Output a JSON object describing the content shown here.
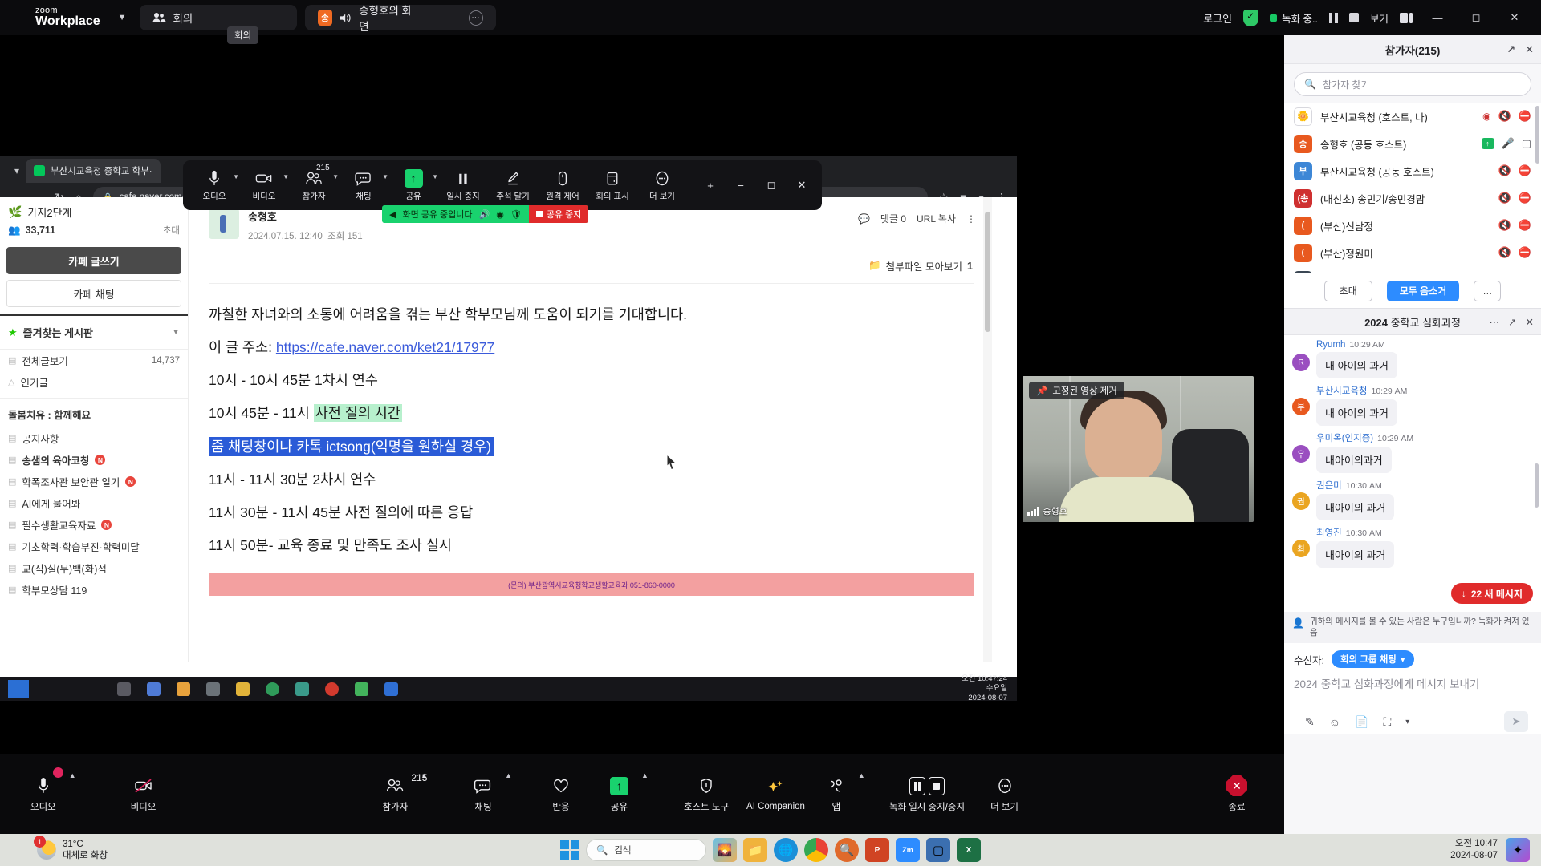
{
  "app": {
    "brand_line1": "zoom",
    "brand_line2": "Workplace",
    "tab_meeting": "회의",
    "tab_share": "송형호의 화면",
    "tab_share_badge": "송",
    "tooltip_meeting": "회의",
    "login": "로그인",
    "recording_status": "녹화 중..",
    "view_label": "보기"
  },
  "share_status": {
    "text": "화면 공유 중입니다",
    "stop_label": "공유 중지"
  },
  "float_controls": [
    {
      "label": "오디오",
      "icon": "microphone-icon",
      "caret": true
    },
    {
      "label": "비디오",
      "icon": "camera-icon",
      "caret": true
    },
    {
      "label": "참가자",
      "icon": "participants-icon",
      "caret": true,
      "count": "215"
    },
    {
      "label": "채팅",
      "icon": "chat-icon",
      "caret": true
    },
    {
      "label": "공유",
      "icon": "share-screen-icon",
      "caret": true
    },
    {
      "label": "일시 중지",
      "icon": "pause-icon",
      "caret": false
    },
    {
      "label": "주석 달기",
      "icon": "annotate-pen-icon",
      "caret": false
    },
    {
      "label": "원격 제어",
      "icon": "remote-control-icon",
      "caret": false
    },
    {
      "label": "회의 표시",
      "icon": "show-meeting-icon",
      "caret": false
    },
    {
      "label": "더 보기",
      "icon": "more-dots-icon",
      "caret": false
    }
  ],
  "browser": {
    "tab_title": "부산시교육청 중학교 학부·",
    "url": "cafe.naver.com/ket21/17977"
  },
  "naver_sidebar": {
    "cafe_name": "가지2단계",
    "member_count": "33,711",
    "invite": "초대",
    "write_button": "카페 글쓰기",
    "chat_button": "카페 채팅",
    "favorites_title": "즐겨찾는 게시판",
    "all_posts": "전체글보기",
    "all_posts_count": "14,737",
    "popular": "인기글",
    "group_title": "돌봄치유 : 함께해요",
    "boards": [
      {
        "label": "공지사항",
        "new": false,
        "bold": false
      },
      {
        "label": "송샘의 육아코칭",
        "new": true,
        "bold": true
      },
      {
        "label": "학폭조사관 보안관 일기",
        "new": true,
        "bold": false
      },
      {
        "label": "AI에게 물어봐",
        "new": false,
        "bold": false
      },
      {
        "label": "필수생활교육자료",
        "new": true,
        "bold": false
      },
      {
        "label": "기초학력·학습부진·학력미달",
        "new": false,
        "bold": false
      },
      {
        "label": "교(직)실(무)백(화)점",
        "new": false,
        "bold": false
      },
      {
        "label": "학부모상담 119",
        "new": false,
        "bold": false
      }
    ]
  },
  "post": {
    "author": "송형호",
    "date": "2024.07.15. 12:40",
    "views": "조회 151",
    "comments": "댓글 0",
    "comments_count": "0",
    "url_copy": "URL 복사",
    "attachments": "첨부파일 모아보기",
    "attachments_count": "1",
    "lines": [
      {
        "text": "까칠한 자녀와의 소통에 어려움을 겪는 부산 학부모님께 도움이 되기를 기대합니다.",
        "type": "plain"
      },
      {
        "prefix": "이 글 주소: ",
        "link": "https://cafe.naver.com/ket21/17977",
        "type": "link"
      },
      {
        "text": "10시 - 10시 45분 1차시 연수",
        "type": "plain"
      },
      {
        "prefix": "10시 45분 - 11시 ",
        "highlight": "사전 질의 시간",
        "type": "green"
      },
      {
        "text": "줌 채팅창이나 카톡 ictsong(익명을 원하실 경우)",
        "type": "blue"
      },
      {
        "text": "11시 - 11시 30분 2차시 연수",
        "type": "plain"
      },
      {
        "text": "11시 30분 - 11시 45분 사전 질의에 따른 응답",
        "type": "plain"
      },
      {
        "text": "11시 50분- 교육 종료 및 만족도 조사 실시",
        "type": "plain"
      }
    ],
    "banner_text": "(문의) 부산광역시교육청학교생활교육과 051-860-0000"
  },
  "captured_taskbar": {
    "time": "오전 10:47:24",
    "weekday": "수요일",
    "date": "2024-08-07"
  },
  "video_thumb": {
    "pin_label": "고정된 영상 제거",
    "name": "송형호"
  },
  "participants_panel": {
    "title": "참가자(215)",
    "search_placeholder": "참가자 찾기",
    "items": [
      {
        "name": "부산시교육청 (호스트, 나)",
        "initial": "부산",
        "color": "#ffffff",
        "avatar_type": "logo",
        "mic": "muted",
        "video": "none",
        "rec": true
      },
      {
        "name": "송형호 (공동 호스트)",
        "initial": "송",
        "color": "#e8591f",
        "mic": "on",
        "video": "on",
        "sharing": true
      },
      {
        "name": "부산시교육청 (공동 호스트)",
        "initial": "부",
        "color": "#3d87d6",
        "mic": "muted",
        "video": "off"
      },
      {
        "name": "(대신초) 송민기/송민경맘",
        "initial": "(송",
        "color": "#cf3030",
        "mic": "muted",
        "video": "off"
      },
      {
        "name": "(부산)신남정",
        "initial": "(",
        "color": "#e8591f",
        "mic": "muted",
        "video": "off"
      },
      {
        "name": "(부산)정원미",
        "initial": "(",
        "color": "#e8591f",
        "mic": "muted",
        "video": "off"
      },
      {
        "name": "..",
        "initial": ".",
        "color": "#3b4754",
        "mic": "muted",
        "video": "off"
      }
    ],
    "invite_button": "초대",
    "mute_all_button": "모두 음소거",
    "more_button": "…"
  },
  "chat_panel": {
    "title_bold": "2024",
    "title_rest": " 중학교 심화과정",
    "messages": [
      {
        "sender": "Ryumh",
        "time": "10:29 AM",
        "text": "내 아이의 과거",
        "initial": "R",
        "color": "#9a4fc0"
      },
      {
        "sender": "부산시교육청",
        "time": "10:29 AM",
        "text": "내 아이의 과거",
        "initial": "부",
        "color": "#e8591f"
      },
      {
        "sender": "우미옥(인지증)",
        "time": "10:29 AM",
        "text": "내아이의과거",
        "initial": "우",
        "color": "#9a4fc0"
      },
      {
        "sender": "권은미",
        "time": "10:30 AM",
        "text": "내아이의 과거",
        "initial": "권",
        "color": "#eaa521"
      },
      {
        "sender": "최영진",
        "time": "10:30 AM",
        "text": "내아이의 과거",
        "initial": "최",
        "color": "#eaa521"
      }
    ],
    "new_messages_button": "22 새 메시지",
    "privacy_note": "귀하의 메시지를 볼 수 있는 사람은 누구입니까? 녹화가 켜져 있음",
    "to_label": "수신자:",
    "to_target": "회의 그룹 채팅",
    "input_placeholder": "2024 중학교 심화과정에게 메시지 보내기",
    "tools": [
      "format-icon",
      "emoji-icon",
      "file-icon",
      "screenshot-icon",
      "chevron-down-icon"
    ],
    "send_icon": "send-icon"
  },
  "zoom_toolbar": [
    {
      "label": "오디오",
      "icon": "microphone-icon",
      "caret": true,
      "badge": true
    },
    {
      "label": "비디오",
      "icon": "camera-off-icon",
      "caret": false
    },
    {
      "label": "참가자",
      "icon": "participants-icon",
      "caret": true,
      "count": "215"
    },
    {
      "label": "채팅",
      "icon": "chat-icon",
      "caret": true
    },
    {
      "label": "반응",
      "icon": "reactions-heart-icon",
      "caret": false
    },
    {
      "label": "공유",
      "icon": "share-screen-icon",
      "caret": true
    },
    {
      "label": "호스트 도구",
      "icon": "host-tools-shield-icon",
      "caret": false
    },
    {
      "label": "AI Companion",
      "icon": "ai-sparkle-icon",
      "caret": false
    },
    {
      "label": "앱",
      "icon": "apps-icon",
      "caret": true
    },
    {
      "label": "녹화 일시 중지/중지",
      "icon": "record-pause-stop-icon",
      "caret": false
    },
    {
      "label": "더 보기",
      "icon": "more-dots-icon",
      "caret": false
    }
  ],
  "zoom_toolbar_end": {
    "label": "종료",
    "icon": "end-meeting-icon"
  },
  "windows_taskbar": {
    "temperature": "31°C",
    "weather": "대체로 화창",
    "weather_badge": "1",
    "search_placeholder": "검색",
    "time": "오전 10:47",
    "date": "2024-08-07"
  }
}
